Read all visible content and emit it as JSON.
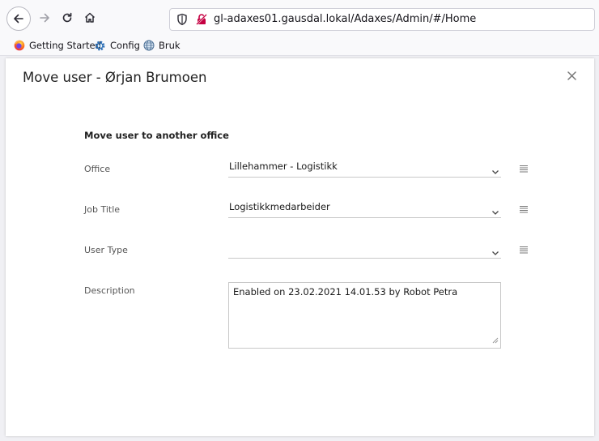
{
  "browser": {
    "url": "gl-adaxes01.gausdal.lokal/Adaxes/Admin/#/Home",
    "bookmarks": [
      {
        "label": "Getting Started",
        "icon": "firefox-icon"
      },
      {
        "label": "Config",
        "icon": "gear-icon"
      },
      {
        "label": "Bruk",
        "icon": "globe-icon"
      }
    ]
  },
  "modal": {
    "title": "Move user - Ørjan Brumoen",
    "section_heading": "Move user to another office",
    "fields": {
      "office": {
        "label": "Office",
        "value": "Lillehammer - Logistikk"
      },
      "job_title": {
        "label": "Job Title",
        "value": "Logistikkmedarbeider"
      },
      "user_type": {
        "label": "User Type",
        "value": ""
      },
      "description": {
        "label": "Description",
        "value": "Enabled on 23.02.2021 14.01.53 by Robot Petra"
      }
    }
  },
  "colors": {
    "chrome_bg": "#f9f9fb",
    "modal_bg": "#ffffff",
    "field_border": "#c8c8c8"
  }
}
